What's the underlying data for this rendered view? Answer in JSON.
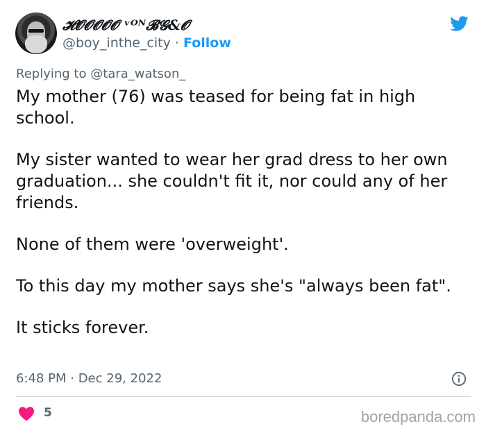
{
  "author": {
    "display_name": "𝓗𝓞𝓞𝓞𝓞𝓞 ᵛᴼᴺ𝓑𝓖&𝓞",
    "handle": "@boy_inthe_city",
    "separator": "·",
    "follow_label": "Follow"
  },
  "reply": {
    "prefix": "Replying to",
    "mention": "@tara_watson_"
  },
  "tweet": {
    "paragraphs": [
      "My mother (76) was teased for being fat in high school.",
      "My sister wanted to wear her grad dress to her own graduation... she couldn't fit it, nor could any of her friends.",
      "None of them were 'overweight'.",
      "To this day my mother says she's \"always been fat\".",
      "It sticks forever."
    ],
    "timestamp": "6:48 PM · Dec 29, 2022"
  },
  "engagement": {
    "likes": "5"
  },
  "watermark": "boredpanda.com",
  "colors": {
    "accent": "#1d9bf0",
    "heart": "#f91880",
    "muted_text": "#536471"
  },
  "icons": {
    "logo": "twitter-bird-icon",
    "info": "info-icon",
    "like": "heart-icon"
  }
}
